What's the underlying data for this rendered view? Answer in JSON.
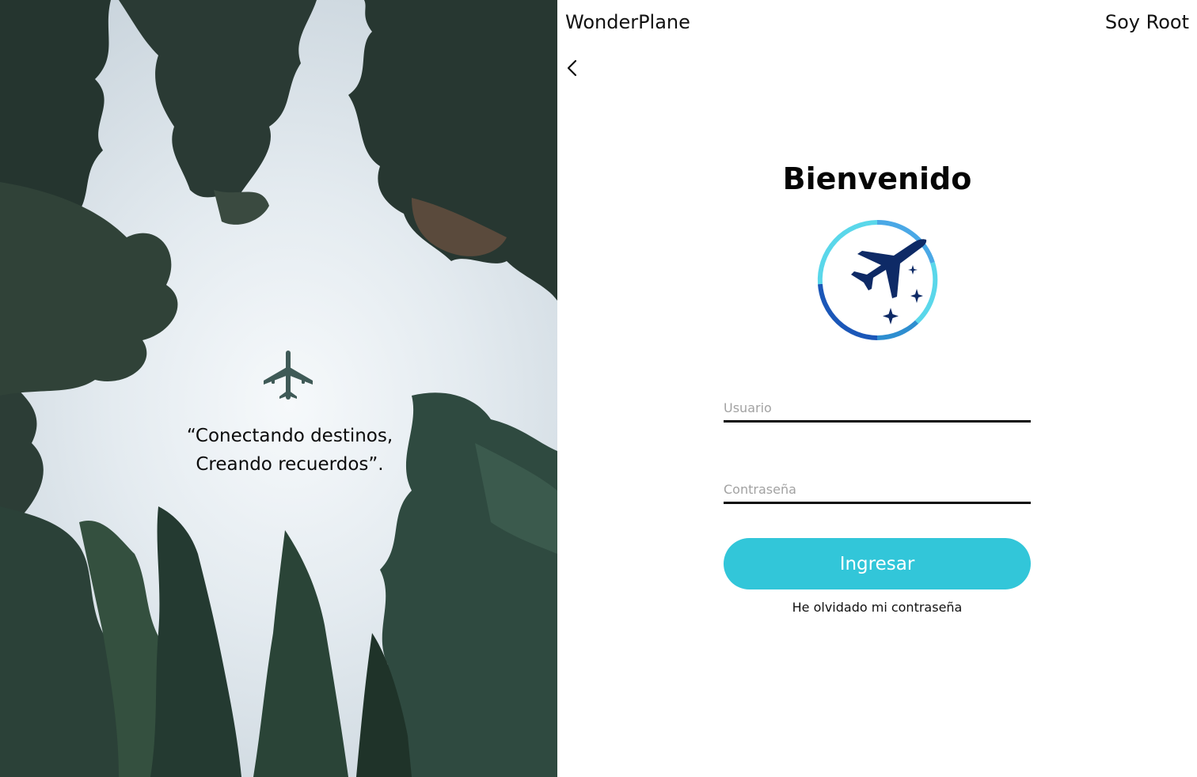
{
  "hero": {
    "quote_line1": "“Conectando destinos,",
    "quote_line2": "Creando recuerdos”.",
    "plane_icon": "airplane-icon"
  },
  "header": {
    "brand": "WonderPlane",
    "user_name": "Soy Root",
    "back_icon": "chevron-left-icon"
  },
  "login": {
    "title": "Bienvenido",
    "logo_icon": "plane-stars-logo-icon",
    "username_placeholder": "Usuario",
    "username_value": "",
    "password_placeholder": "Contraseña",
    "password_value": "",
    "submit_label": "Ingresar",
    "forgot_label": "He olvidado mi contraseña"
  },
  "colors": {
    "accent": "#32c6d9",
    "logo_navy": "#0e2a66",
    "logo_ring_blue": "#1b57b8",
    "logo_ring_cyan": "#5ad7ea"
  }
}
